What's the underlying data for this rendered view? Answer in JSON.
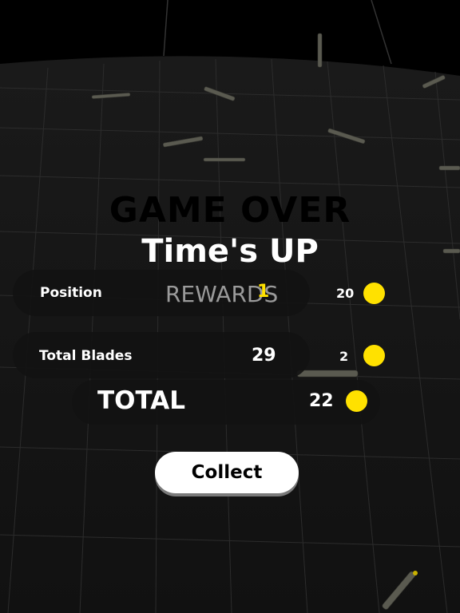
{
  "screen": {
    "game_over": "GAME OVER",
    "subtitle": "Time's UP",
    "rewards_label": "REWARDS"
  },
  "rows": [
    {
      "label": "Position",
      "value": "1",
      "reward": "20",
      "icon": "coin-icon"
    },
    {
      "label": "Total Blades",
      "value": "29",
      "reward": "2",
      "icon": "coin-icon"
    }
  ],
  "total": {
    "label": "TOTAL",
    "value": "22",
    "icon": "coin-icon"
  },
  "collect_button": {
    "label": "Collect"
  },
  "colors": {
    "background": "#0a0a0a",
    "coin": "#ffe100",
    "position_highlight": "#ffe100",
    "button": "#ffffff"
  }
}
